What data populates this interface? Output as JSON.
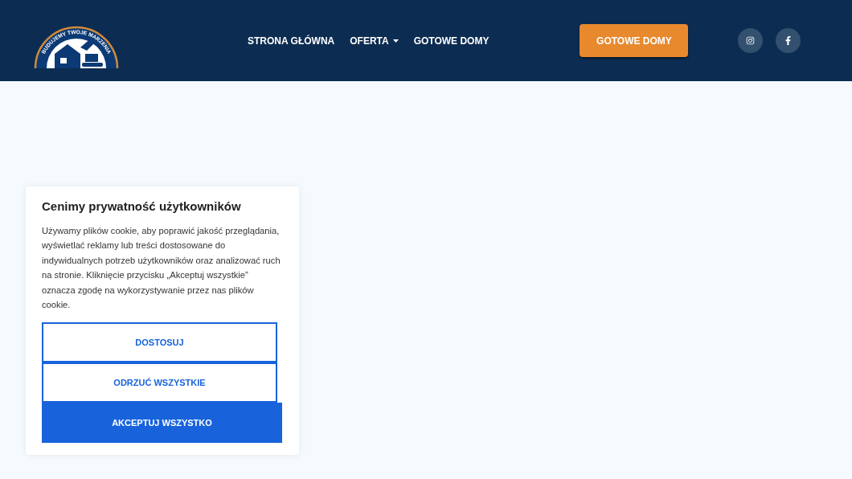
{
  "header": {
    "logo_text": "BUDUJEMY TWOJE MARZENIA",
    "nav": [
      {
        "label": "STRONA GŁÓWNA",
        "has_dropdown": false
      },
      {
        "label": "OFERTA",
        "has_dropdown": true
      },
      {
        "label": "GOTOWE DOMY",
        "has_dropdown": false
      }
    ],
    "cta": "GOTOWE DOMY",
    "social": [
      {
        "kind": "instagram"
      },
      {
        "kind": "facebook"
      }
    ]
  },
  "cookie_banner": {
    "title": "Cenimy prywatność użytkowników",
    "text": "Używamy plików cookie, aby poprawić jakość przeglądania, wyświetlać reklamy lub treści dostosowane do indywidualnych potrzeb użytkowników oraz analizować ruch na stronie. Kliknięcie przycisku „Akceptuj wszystkie” oznacza zgodę na wykorzystywanie przez nas plików cookie.",
    "buttons": [
      {
        "label": "DOSTOSUJ",
        "kind": "outline"
      },
      {
        "label": "ODRZUĆ WSZYSTKIE",
        "kind": "outline"
      },
      {
        "label": "AKCEPTUJ WSZYSTKO",
        "kind": "filled"
      }
    ]
  }
}
